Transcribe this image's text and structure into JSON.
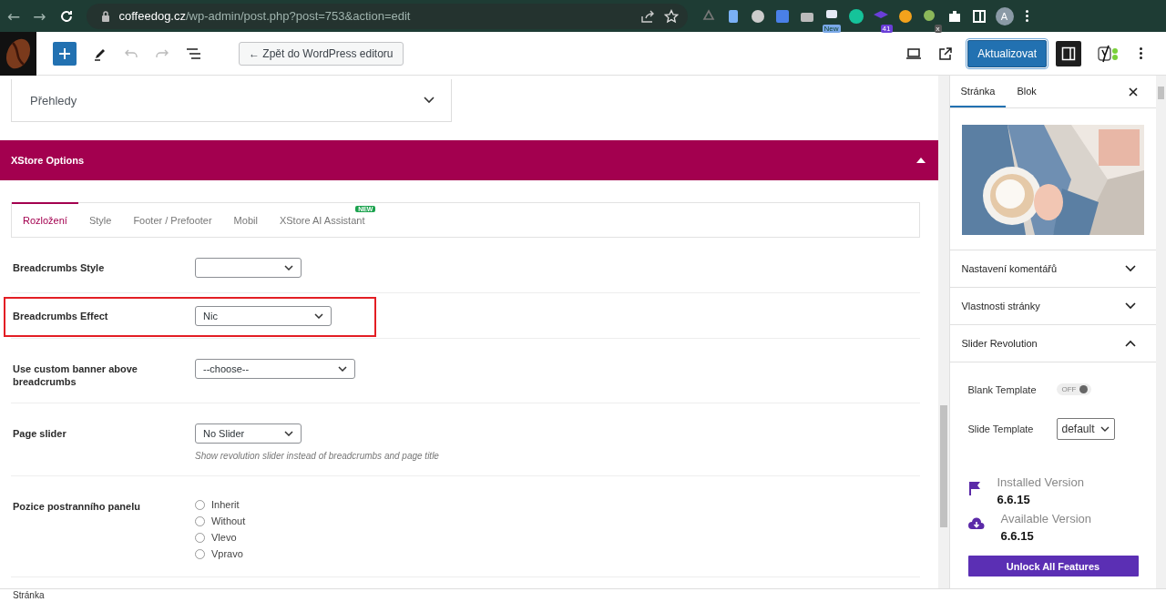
{
  "browser": {
    "url_host": "coffeedog.cz",
    "url_path": "/wp-admin/post.php?post=753&action=edit",
    "extensions": [
      {
        "kind": "recycle"
      },
      {
        "kind": "docs"
      },
      {
        "kind": "globe"
      },
      {
        "kind": "translate"
      },
      {
        "kind": "camera"
      },
      {
        "kind": "new",
        "badge": "New"
      },
      {
        "kind": "grammarly"
      },
      {
        "kind": "cap",
        "badge": "41"
      },
      {
        "kind": "moon"
      },
      {
        "kind": "gem",
        "badge": "x"
      },
      {
        "kind": "puzzle"
      },
      {
        "kind": "sidepanel"
      }
    ],
    "avatar": "A",
    "back": "←",
    "forward": "→"
  },
  "toolbar": {
    "back_button": "← Zpět do WordPress editoru",
    "update_button": "Aktualizovat"
  },
  "main": {
    "collapsed_panel": {
      "title": "Přehledy",
      "expanded": false
    },
    "section": {
      "title": "XStore Options",
      "expanded": true
    },
    "tabs": [
      {
        "label": "Rozložení",
        "selected": true
      },
      {
        "label": "Style",
        "selected": false
      },
      {
        "label": "Footer / Prefooter",
        "selected": false
      },
      {
        "label": "Mobil",
        "selected": false
      },
      {
        "label": "XStore AI Assistant",
        "selected": false,
        "badge": "NEW"
      }
    ],
    "fields": [
      {
        "kind": "select",
        "label": "Breadcrumbs Style",
        "highlighted": false
      },
      {
        "kind": "select",
        "label": "Breadcrumbs Effect",
        "value": "Nic",
        "highlighted": true
      },
      {
        "kind": "select",
        "label": "Use custom banner above breadcrumbs",
        "value": "--choose--",
        "highlighted": false
      },
      {
        "kind": "select",
        "label": "Page slider",
        "value": "No Slider",
        "hint": "Show revolution slider instead of breadcrumbs and page title",
        "highlighted": false
      },
      {
        "kind": "radio",
        "label": "Pozice postranního panelu",
        "options": [
          {
            "label": "Inherit",
            "selected": false
          },
          {
            "label": "Without",
            "selected": false
          },
          {
            "label": "Vlevo",
            "selected": false
          },
          {
            "label": "Vpravo",
            "selected": false
          }
        ],
        "highlighted": false
      }
    ]
  },
  "sidebar": {
    "tabs": [
      {
        "label": "Stránka",
        "selected": true
      },
      {
        "label": "Blok",
        "selected": false
      }
    ],
    "panels": [
      {
        "title": "Nastavení komentářů",
        "expanded": false
      },
      {
        "title": "Vlastnosti stránky",
        "expanded": false
      },
      {
        "title": "Slider Revolution",
        "expanded": true
      }
    ],
    "slider_revolution": {
      "blank_template": {
        "label": "Blank Template",
        "on": false,
        "state_text": "OFF"
      },
      "slide_template": {
        "label": "Slide Template",
        "value": "default"
      },
      "versions": [
        {
          "kind": "installed",
          "label": "Installed Version",
          "value": "6.6.15"
        },
        {
          "kind": "available",
          "label": "Available Version",
          "value": "6.6.15"
        }
      ],
      "unlock_button": "Unlock All Features"
    }
  },
  "footer": {
    "breadcrumb": "Stránka"
  }
}
